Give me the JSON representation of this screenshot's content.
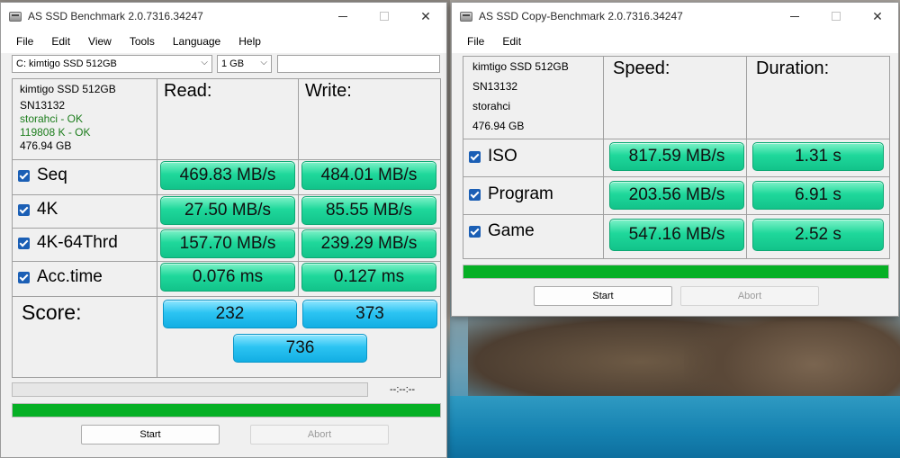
{
  "main_window": {
    "title": "AS SSD Benchmark 2.0.7316.34247",
    "menu": [
      "File",
      "Edit",
      "View",
      "Tools",
      "Language",
      "Help"
    ],
    "drive_select": "C: kimtigo SSD 512GB",
    "size_select": "1 GB",
    "drive_info": {
      "model": "kimtigo SSD 512GB",
      "serial": "SN13132",
      "driver": "storahci - OK",
      "alignment": "119808 K - OK",
      "capacity": "476.94 GB"
    },
    "col_read": "Read:",
    "col_write": "Write:",
    "rows": [
      {
        "label": "Seq",
        "read": "469.83 MB/s",
        "write": "484.01 MB/s"
      },
      {
        "label": "4K",
        "read": "27.50 MB/s",
        "write": "85.55 MB/s"
      },
      {
        "label": "4K-64Thrd",
        "read": "157.70 MB/s",
        "write": "239.29 MB/s"
      },
      {
        "label": "Acc.time",
        "read": "0.076 ms",
        "write": "0.127 ms"
      }
    ],
    "score_label": "Score:",
    "score_read": "232",
    "score_write": "373",
    "score_total": "736",
    "elapsed": "--:--:--",
    "progress": 1.0,
    "start_label": "Start",
    "abort_label": "Abort"
  },
  "copy_window": {
    "title": "AS SSD Copy-Benchmark 2.0.7316.34247",
    "menu": [
      "File",
      "Edit"
    ],
    "drive_info": {
      "model": "kimtigo SSD 512GB",
      "serial": "SN13132",
      "driver": "storahci",
      "capacity": "476.94 GB"
    },
    "col_speed": "Speed:",
    "col_duration": "Duration:",
    "rows": [
      {
        "label": "ISO",
        "speed": "817.59 MB/s",
        "duration": "1.31 s"
      },
      {
        "label": "Program",
        "speed": "203.56 MB/s",
        "duration": "6.91 s"
      },
      {
        "label": "Game",
        "speed": "547.16 MB/s",
        "duration": "2.52 s"
      }
    ],
    "progress": 1.0,
    "start_label": "Start",
    "abort_label": "Abort"
  },
  "colors": {
    "result_green": "#1fd89b",
    "score_blue": "#2cc4f2",
    "progress_green": "#06b025",
    "ok_text": "#1c7d1c"
  }
}
